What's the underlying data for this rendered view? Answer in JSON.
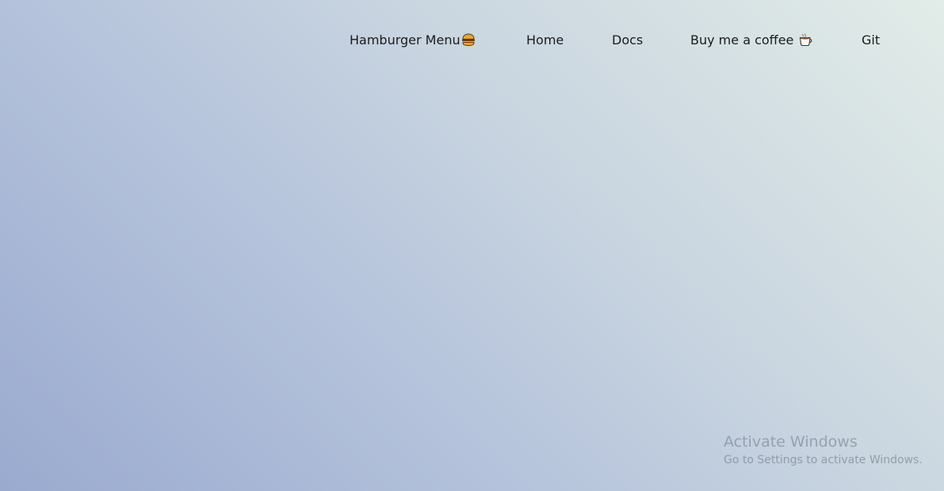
{
  "nav": {
    "items": [
      {
        "label": "Hamburger Menu",
        "icon": "burger-icon"
      },
      {
        "label": "Home"
      },
      {
        "label": "Docs"
      },
      {
        "label": "Buy me a coffee",
        "icon": "coffee-icon"
      },
      {
        "label": "Git"
      }
    ]
  },
  "colors": {
    "gradient_start": "#9aaacf",
    "gradient_end": "#e2ece8",
    "text": "#1b1b1b"
  },
  "watermark": {
    "title": "Activate Windows",
    "subtitle": "Go to Settings to activate Windows."
  }
}
